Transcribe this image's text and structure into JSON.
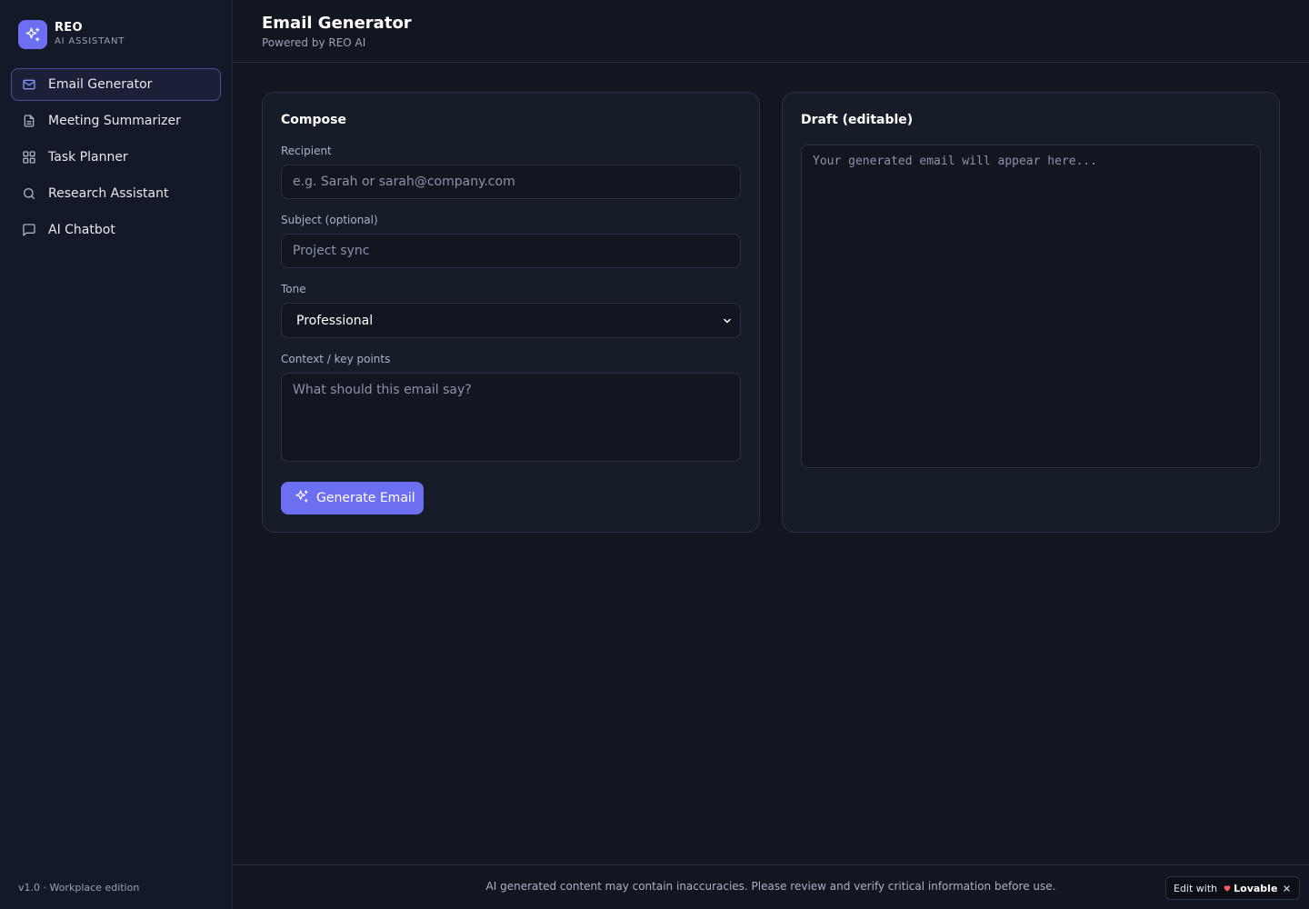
{
  "brand": {
    "name": "REO",
    "subtitle": "AI ASSISTANT",
    "logo_icon": "sparkles-icon",
    "accent_color": "#6c6ff2"
  },
  "sidebar": {
    "items": [
      {
        "label": "Email Generator",
        "icon": "mail-icon",
        "active": true
      },
      {
        "label": "Meeting Summarizer",
        "icon": "document-icon",
        "active": false
      },
      {
        "label": "Task Planner",
        "icon": "grid-icon",
        "active": false
      },
      {
        "label": "Research Assistant",
        "icon": "search-icon",
        "active": false
      },
      {
        "label": "AI Chatbot",
        "icon": "chat-icon",
        "active": false
      }
    ],
    "version": "v1.0 · Workplace edition"
  },
  "header": {
    "title": "Email Generator",
    "subtitle": "Powered by REO AI"
  },
  "compose": {
    "title": "Compose",
    "recipient": {
      "label": "Recipient",
      "value": "",
      "placeholder": "e.g. Sarah or sarah@company.com"
    },
    "subject": {
      "label": "Subject (optional)",
      "value": "",
      "placeholder": "Project sync"
    },
    "tone": {
      "label": "Tone",
      "value": "Professional"
    },
    "context": {
      "label": "Context / key points",
      "value": "",
      "placeholder": "What should this email say?"
    },
    "generate_button": "Generate Email"
  },
  "draft": {
    "title": "Draft (editable)",
    "value": "",
    "placeholder": "Your generated email will appear here..."
  },
  "footer": {
    "disclaimer": "AI generated content may contain inaccuracies. Please review and verify critical information before use.",
    "badge_prefix": "Edit with",
    "badge_brand": "Lovable"
  }
}
